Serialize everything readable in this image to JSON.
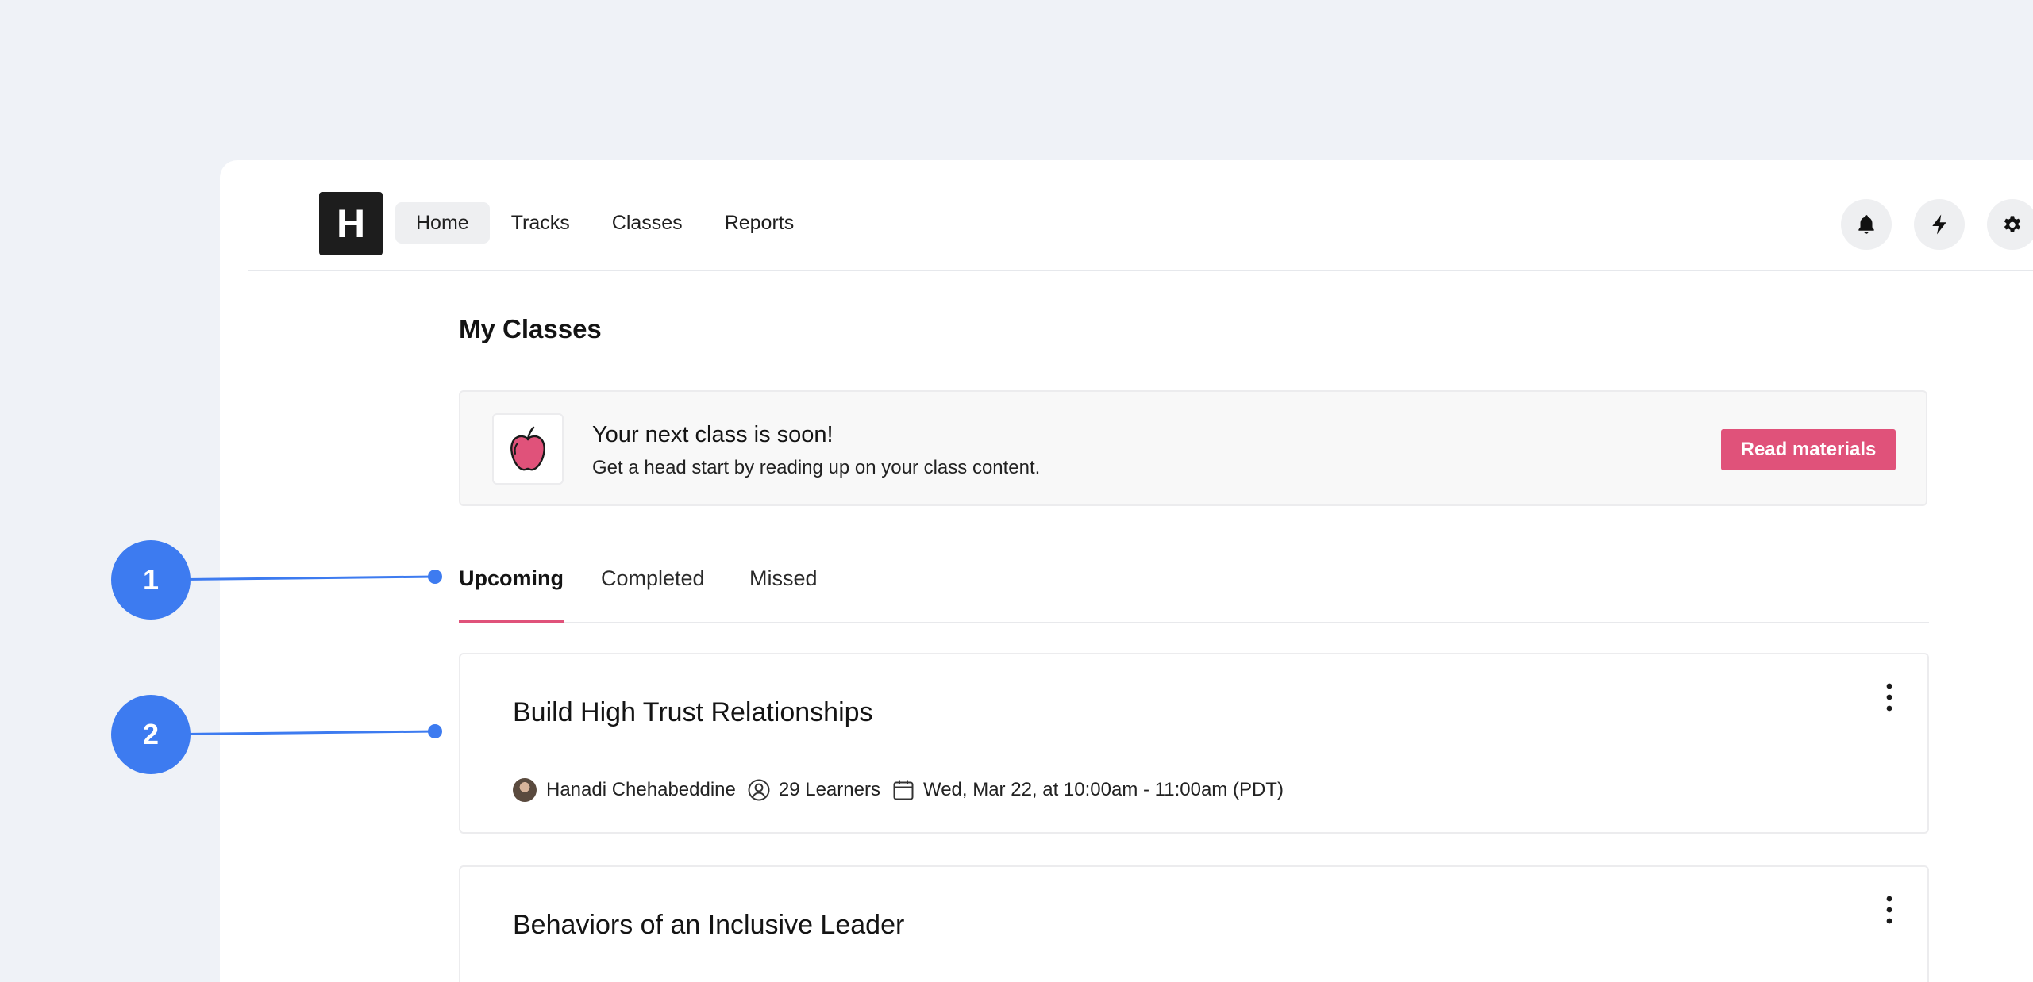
{
  "nav": {
    "logo_letter": "H",
    "links": [
      {
        "label": "Home",
        "active": true
      },
      {
        "label": "Tracks",
        "active": false
      },
      {
        "label": "Classes",
        "active": false
      },
      {
        "label": "Reports",
        "active": false
      }
    ],
    "icons": [
      "bell-icon",
      "lightning-icon",
      "gear-icon"
    ]
  },
  "page": {
    "title": "My Classes"
  },
  "banner": {
    "icon": "apple-icon",
    "title": "Your next class is soon!",
    "subtitle": "Get a head start by reading up on your class content.",
    "button_label": "Read materials"
  },
  "tabs": [
    {
      "label": "Upcoming",
      "active": true
    },
    {
      "label": "Completed",
      "active": false
    },
    {
      "label": "Missed",
      "active": false
    }
  ],
  "classes": [
    {
      "title": "Build High Trust Relationships",
      "instructor": "Hanadi Chehabeddine",
      "learners": "29 Learners",
      "schedule": "Wed, Mar 22, at 10:00am - 11:00am (PDT)"
    },
    {
      "title": "Behaviors of an Inclusive Leader"
    }
  ],
  "annotations": [
    {
      "number": "1"
    },
    {
      "number": "2"
    }
  ],
  "colors": {
    "accent": "#e0527a",
    "annotation": "#3d7bf0",
    "background": "#eff2f7"
  }
}
